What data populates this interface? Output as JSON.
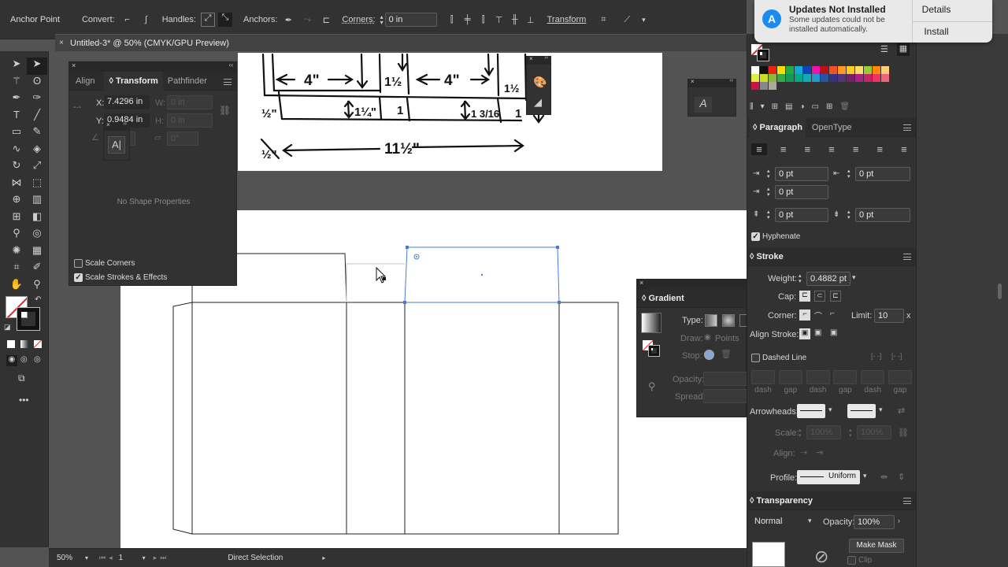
{
  "control_bar": {
    "tool_label": "Anchor Point",
    "convert_label": "Convert:",
    "handles_label": "Handles:",
    "anchors_label": "Anchors:",
    "corners_label": "Corners:",
    "corners_value": "0 in",
    "transform_label": "Transform"
  },
  "doc_tab": {
    "title": "Untitled-3* @ 50% (CMYK/GPU Preview)"
  },
  "notification": {
    "title": "Updates Not Installed",
    "message": "Some updates could not be installed automatically.",
    "details_label": "Details",
    "install_label": "Install"
  },
  "transform_panel": {
    "tabs": [
      "Align",
      "Transform",
      "Pathfinder"
    ],
    "x_label": "X:",
    "x_value": "7.4296 in",
    "y_label": "Y:",
    "y_value": "0.9484 in",
    "w_label": "W:",
    "w_value": "0 in",
    "h_label": "H:",
    "h_value": "0 in",
    "angle_value": "0°",
    "shear_value": "0°",
    "no_shape": "No Shape Properties",
    "scale_corners": "Scale Corners",
    "scale_strokes": "Scale Strokes & Effects"
  },
  "paragraph_panel": {
    "tabs": [
      "Paragraph",
      "OpenType"
    ],
    "left_indent": "0 pt",
    "right_indent": "0 pt",
    "first_indent": "0 pt",
    "space_before": "0 pt",
    "space_after": "0 pt",
    "hyphenate": "Hyphenate"
  },
  "stroke_panel": {
    "title": "Stroke",
    "weight_label": "Weight:",
    "weight_value": "0.4882 pt",
    "cap_label": "Cap:",
    "corner_label": "Corner:",
    "limit_label": "Limit:",
    "limit_value": "10",
    "limit_unit": "x",
    "align_label": "Align Stroke:",
    "dashed_label": "Dashed Line",
    "dash_labels": [
      "dash",
      "gap",
      "dash",
      "gap",
      "dash",
      "gap"
    ],
    "arrowheads_label": "Arrowheads:",
    "scale_label": "Scale:",
    "scale_value1": "100%",
    "scale_value2": "100%",
    "align_arrow_label": "Align:",
    "profile_label": "Profile:",
    "profile_value": "Uniform"
  },
  "transparency_panel": {
    "title": "Transparency",
    "mode": "Normal",
    "opacity_label": "Opacity:",
    "opacity_value": "100%",
    "make_mask": "Make Mask",
    "clip": "Clip"
  },
  "gradient_panel": {
    "title": "Gradient",
    "type_label": "Type:",
    "draw_label": "Draw:",
    "points_label": "Points",
    "stop_label": "Stop:",
    "opacity_label": "Opacity:",
    "spread_label": "Spread:"
  },
  "status_bar": {
    "zoom": "50%",
    "artboard": "1",
    "tool": "Direct Selection"
  },
  "sketch_labels": [
    "4\"",
    "1½",
    "4\"",
    "1½",
    "½\"",
    "1¼\"",
    "1",
    "1 3/16",
    "1",
    "½\"",
    "11½\""
  ],
  "colors": {
    "selection": "#4a7bd0",
    "accent": "#1473e6"
  }
}
